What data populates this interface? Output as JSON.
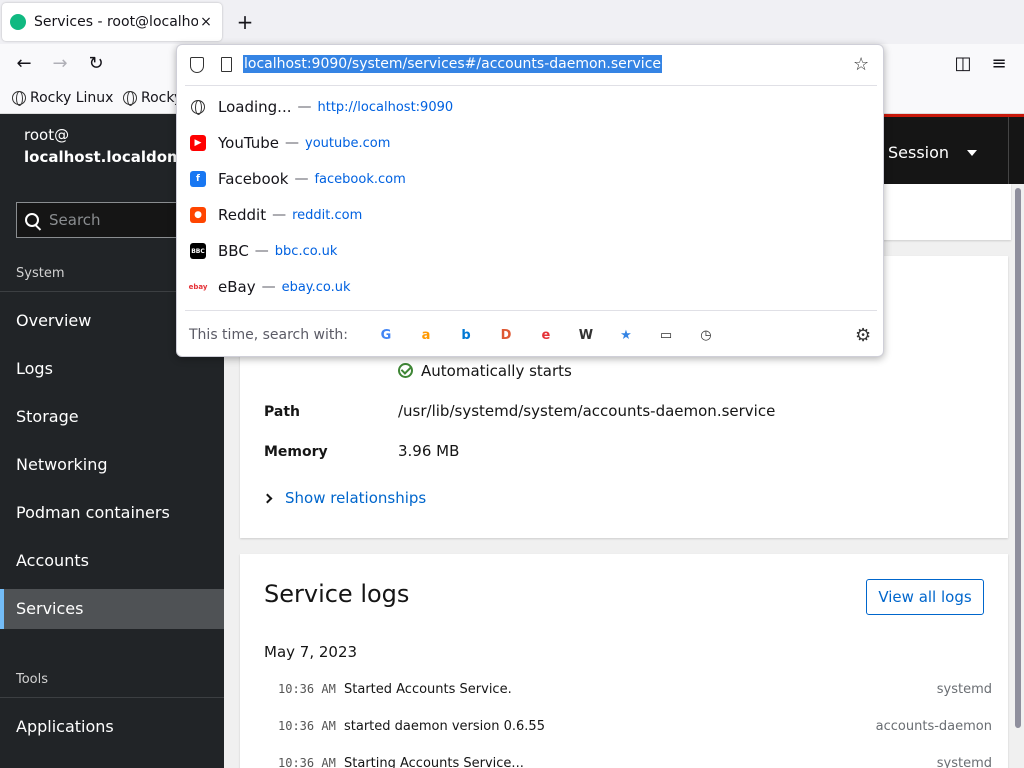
{
  "browser": {
    "tab_title": "Services - root@localhost",
    "tab_close": "×",
    "new_tab": "+",
    "back": "←",
    "forward": "→",
    "reload": "↻",
    "pocket": "◫",
    "menu": "≡",
    "bookmarks": [
      "Rocky Linux",
      "Rocky"
    ]
  },
  "urlbar": {
    "url": "localhost:9090/system/services#/accounts-daemon.service",
    "star": "☆",
    "suggestions": [
      {
        "name": "Loading...",
        "url": "http://localhost:9090",
        "icon": "globe-icon",
        "color": "#555555",
        "glyph": ""
      },
      {
        "name": "YouTube",
        "url": "youtube.com",
        "icon": "youtube-icon",
        "color": "#ff0000",
        "glyph": "▶"
      },
      {
        "name": "Facebook",
        "url": "facebook.com",
        "icon": "facebook-icon",
        "color": "#1877f2",
        "glyph": "f"
      },
      {
        "name": "Reddit",
        "url": "reddit.com",
        "icon": "reddit-icon",
        "color": "#ff4500",
        "glyph": "●"
      },
      {
        "name": "BBC",
        "url": "bbc.co.uk",
        "icon": "bbc-icon",
        "color": "#000000",
        "glyph": "BBC"
      },
      {
        "name": "eBay",
        "url": "ebay.co.uk",
        "icon": "ebay-icon",
        "color": "#ffffff",
        "glyph": "ebay"
      }
    ],
    "dash": "—",
    "search_with_label": "This time, search with:",
    "engines": [
      {
        "name": "google-icon",
        "glyph": "G",
        "color": "#4285f4"
      },
      {
        "name": "amazon-icon",
        "glyph": "a",
        "color": "#ff9900"
      },
      {
        "name": "bing-icon",
        "glyph": "b",
        "color": "#0078d4"
      },
      {
        "name": "duckduckgo-icon",
        "glyph": "D",
        "color": "#de5833"
      },
      {
        "name": "ebay-search-icon",
        "glyph": "e",
        "color": "#e53238"
      },
      {
        "name": "wikipedia-icon",
        "glyph": "W",
        "color": "#333333"
      },
      {
        "name": "bookmarks-icon",
        "glyph": "★",
        "color": "#3584e4"
      },
      {
        "name": "tabs-icon",
        "glyph": "▭",
        "color": "#333333"
      },
      {
        "name": "history-icon",
        "glyph": "◷",
        "color": "#333333"
      }
    ],
    "settings": "⚙"
  },
  "cockpit": {
    "host_user": "root@",
    "host_name": "localhost.localdom...",
    "search_placeholder": "Search",
    "section_system": "System",
    "nav": [
      "Overview",
      "Logs",
      "Storage",
      "Networking",
      "Podman containers",
      "Accounts",
      "Services"
    ],
    "active_nav": "Services",
    "section_tools": "Tools",
    "tools_nav": [
      "Applications"
    ],
    "session_label": "Session",
    "status_text": "Automatically starts",
    "path_label": "Path",
    "path_value": "/usr/lib/systemd/system/accounts-daemon.service",
    "memory_label": "Memory",
    "memory_value": "3.96 MB",
    "show_relationships": "Show relationships",
    "logs_title": "Service logs",
    "view_all_logs": "View all logs",
    "log_date": "May 7, 2023",
    "logs": [
      {
        "time": "10:36 AM",
        "message": "Started Accounts Service.",
        "source": "systemd"
      },
      {
        "time": "10:36 AM",
        "message": "started daemon version 0.6.55",
        "source": "accounts-daemon"
      },
      {
        "time": "10:36 AM",
        "message": "Starting Accounts Service...",
        "source": "systemd"
      }
    ]
  }
}
